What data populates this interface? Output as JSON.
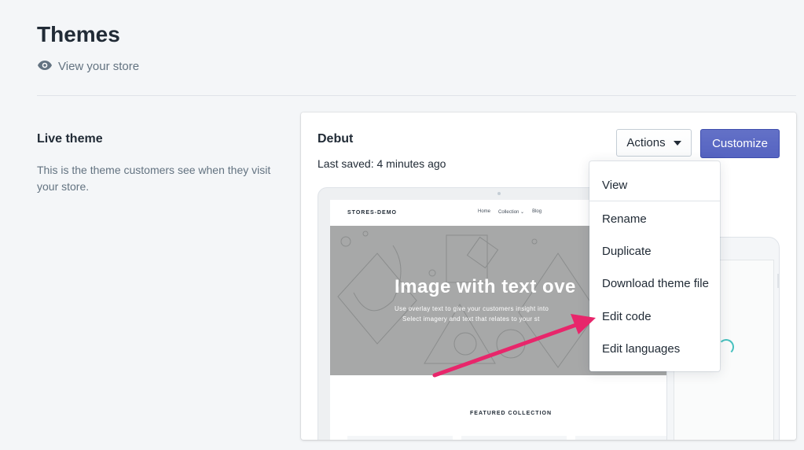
{
  "header": {
    "title": "Themes",
    "view_store_label": "View your store"
  },
  "live_theme": {
    "section_title": "Live theme",
    "section_description": "This is the theme customers see when they visit your store."
  },
  "theme_card": {
    "name": "Debut",
    "last_saved": "Last saved: 4 minutes ago",
    "actions_label": "Actions",
    "customize_label": "Customize"
  },
  "preview": {
    "store_name": "STORES-DEMO",
    "nav": [
      "Home",
      "Collection ⌄",
      "Blog"
    ],
    "hero_title": "Image with text ove",
    "hero_sub1": "Use overlay text to give your customers insight into",
    "hero_sub2": "Select imagery and text that relates to your st",
    "featured": "FEATURED COLLECTION"
  },
  "actions_menu": {
    "items": [
      "View",
      "Rename",
      "Duplicate",
      "Download theme file",
      "Edit code",
      "Edit languages"
    ]
  },
  "colors": {
    "accent": "#5c6ac4",
    "annotation_arrow": "#e8266b",
    "background": "#f4f6f8"
  },
  "icons": {
    "view_store": "eye-icon",
    "actions_caret": "caret-down-icon"
  }
}
